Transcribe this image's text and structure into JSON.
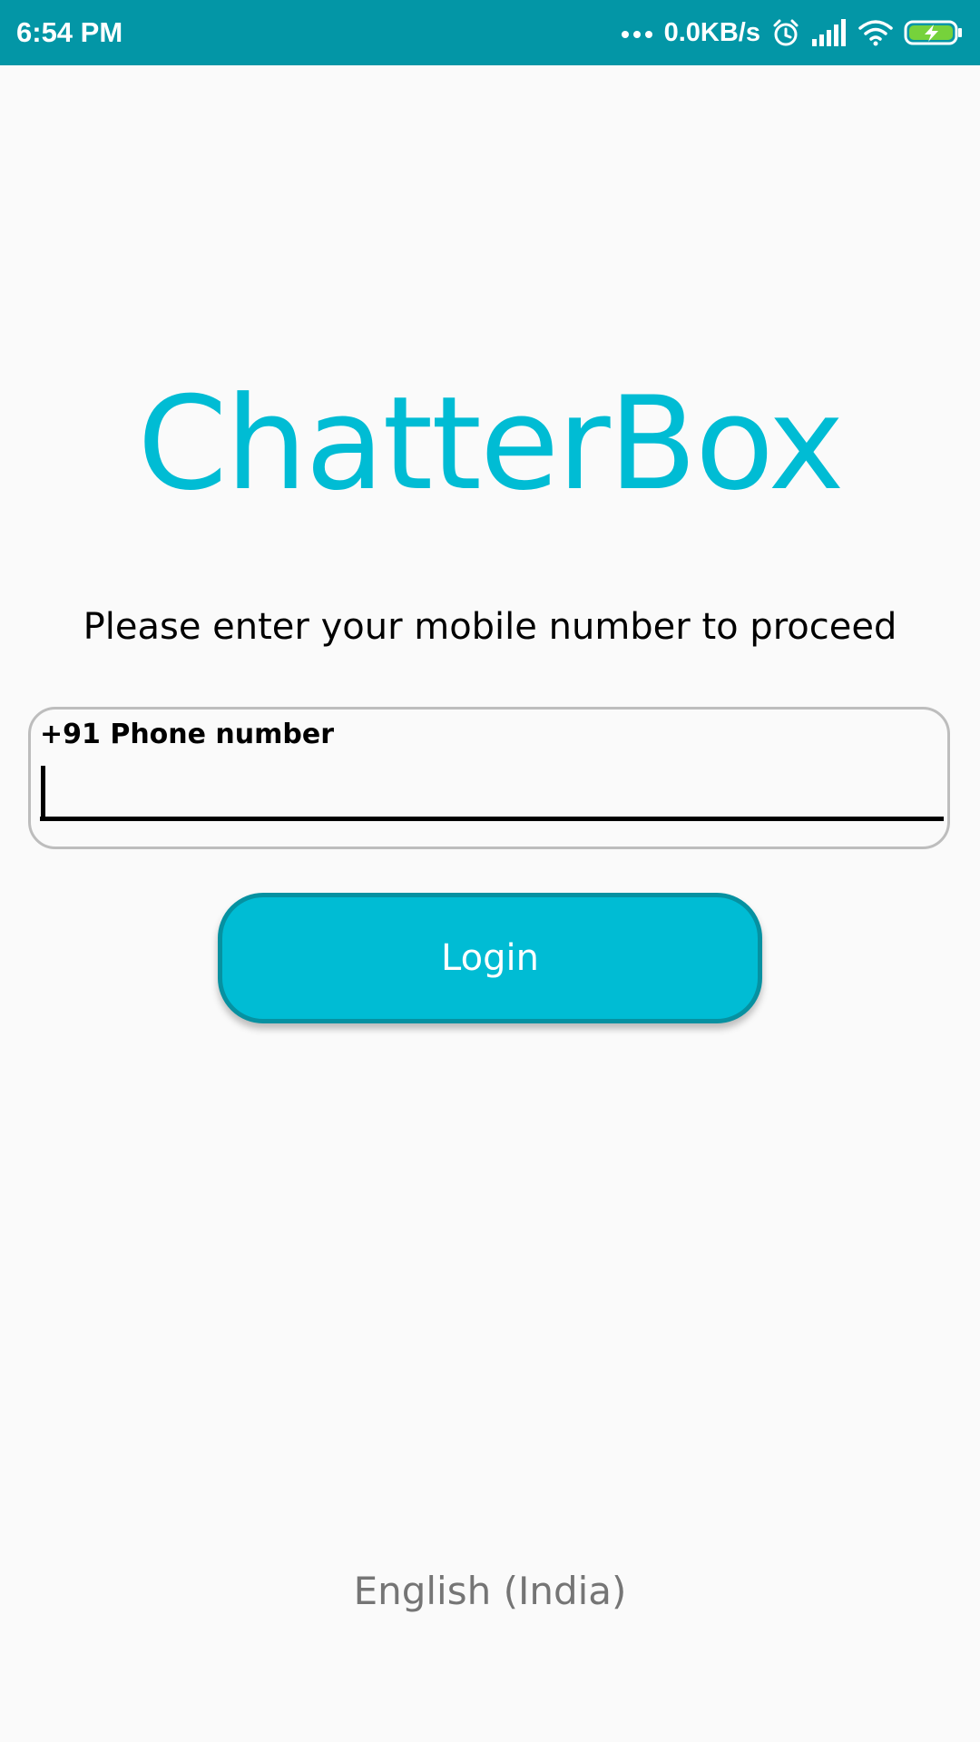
{
  "status_bar": {
    "time": "6:54 PM",
    "network_speed": "0.0KB/s",
    "icons": [
      "more-dots-icon",
      "alarm-icon",
      "signal-icon",
      "wifi-icon",
      "battery-charging-icon"
    ]
  },
  "app": {
    "title": "ChatterBox"
  },
  "login_form": {
    "prompt": "Please enter your mobile number to proceed",
    "phone_label": "+91 Phone number",
    "phone_value": "",
    "login_label": "Login"
  },
  "footer": {
    "language": "English (India)"
  },
  "colors": {
    "status_bar": "#0396a6",
    "accent": "#00bcd4",
    "button_border": "#0691a1",
    "battery": "#76d23b"
  }
}
